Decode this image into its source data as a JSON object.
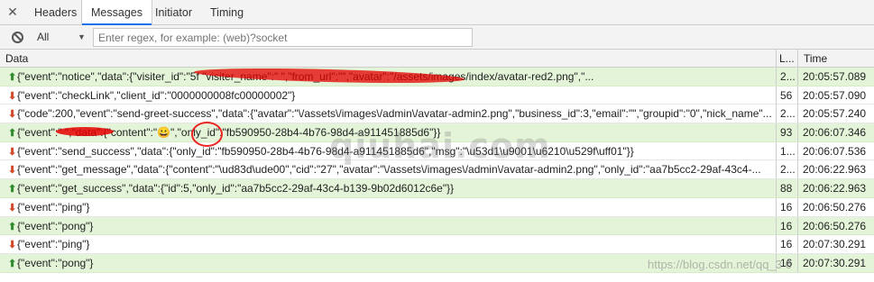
{
  "tabs": {
    "close_glyph": "✕",
    "items": [
      {
        "label": "Headers"
      },
      {
        "label": "Messages"
      },
      {
        "label": "Initiator"
      },
      {
        "label": "Timing"
      }
    ],
    "active_index": 1
  },
  "filter": {
    "type_label": "All",
    "dropdown_glyph": "▼",
    "placeholder": "Enter regex, for example: (web)?socket",
    "value": ""
  },
  "grid": {
    "headers": {
      "data": "Data",
      "length": "L...",
      "time": "Time"
    },
    "rows": [
      {
        "direction": "send",
        "arrow": "⬆",
        "data": "{\"event\":\"notice\",\"data\":{\"visiter_id\":\"5f          \"visiter_name\":\"                              \",\"from_url\":\"\",\"avatar\":\"/assets/images/index/avatar-red2.png\",\"...",
        "length": "2...",
        "time": "20:05:57.089"
      },
      {
        "direction": "receive",
        "arrow": "⬇",
        "data": "{\"event\":\"checkLink\",\"client_id\":\"0000000008fc00000002\"}",
        "length": "56",
        "time": "20:05:57.090"
      },
      {
        "direction": "receive",
        "arrow": "⬇",
        "data": "{\"code\":200,\"event\":\"send-greet-success\",\"data\":{\"avatar\":\"\\/assets\\/images\\/admin\\/avatar-admin2.png\",\"business_id\":3,\"email\":\"\",\"groupid\":\"0\",\"nick_name\"...",
        "length": "2...",
        "time": "20:05:57.240"
      },
      {
        "direction": "send",
        "arrow": "⬆",
        "data": "{\"event\":\"          \",\"data\":{\"content\":\"😀\",\"only_id\":\"fb590950-28b4-4b76-98d4-a911451885d6\"}}",
        "length": "93",
        "time": "20:06:07.346"
      },
      {
        "direction": "receive",
        "arrow": "⬇",
        "data": "{\"event\":\"send_success\",\"data\":{\"only_id\":\"fb590950-28b4-4b76-98d4-a911451885d6\",\"msg\":\"\\u53d1\\u9001\\u6210\\u529f\\uff01\"}}",
        "length": "1...",
        "time": "20:06:07.536"
      },
      {
        "direction": "receive",
        "arrow": "⬇",
        "data": "{\"event\":\"get_message\",\"data\":{\"content\":\"\\ud83d\\ude00\",\"cid\":\"27\",\"avatar\":\"\\/assets\\/images\\/admin\\/avatar-admin2.png\",\"only_id\":\"aa7b5cc2-29af-43c4-...",
        "length": "2...",
        "time": "20:06:22.963"
      },
      {
        "direction": "send",
        "arrow": "⬆",
        "data": "{\"event\":\"get_success\",\"data\":{\"id\":5,\"only_id\":\"aa7b5cc2-29af-43c4-b139-9b02d6012c6e\"}}",
        "length": "88",
        "time": "20:06:22.963"
      },
      {
        "direction": "receive",
        "arrow": "⬇",
        "data": "{\"event\":\"ping\"}",
        "length": "16",
        "time": "20:06:50.276"
      },
      {
        "direction": "send",
        "arrow": "⬆",
        "data": "{\"event\":\"pong\"}",
        "length": "16",
        "time": "20:06:50.276"
      },
      {
        "direction": "receive",
        "arrow": "⬇",
        "data": "{\"event\":\"ping\"}",
        "length": "16",
        "time": "20:07:30.291"
      },
      {
        "direction": "send",
        "arrow": "⬆",
        "data": "{\"event\":\"pong\"}",
        "length": "16",
        "time": "20:07:30.291"
      }
    ]
  },
  "watermarks": {
    "center": "qiuhai.com",
    "bottom": "https://blog.csdn.net/qq_3          6"
  },
  "colors": {
    "send_row_bg": "#e4f4d8",
    "send_arrow": "#2e8b2e",
    "receive_arrow": "#d14a2a",
    "active_tab_underline": "#1a73e8",
    "annotation_red": "#e22222"
  },
  "icons": {
    "close": "close-icon",
    "block": "block-icon",
    "dropdown": "chevron-down-icon",
    "send": "arrow-up-icon",
    "receive": "arrow-down-icon"
  }
}
